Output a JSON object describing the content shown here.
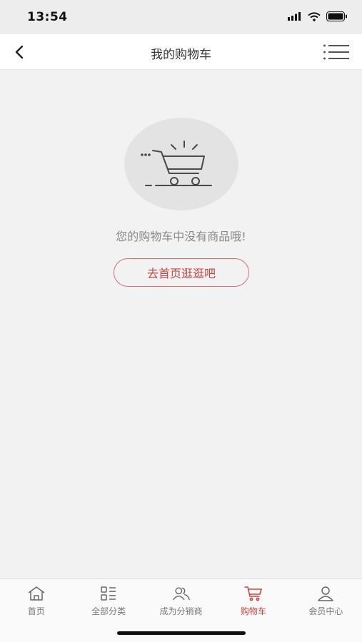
{
  "status_bar": {
    "time": "13:54"
  },
  "header": {
    "title": "我的购物车",
    "back_icon": "chevron-left-icon",
    "menu_icon": "list-menu-icon"
  },
  "empty_state": {
    "illustration": "shopping-cart-icon",
    "message": "您的购物车中没有商品哦!",
    "button_label": "去首页逛逛吧"
  },
  "colors": {
    "accent": "#c8453f",
    "background": "#f2f2f2",
    "header_bg": "#ffffff"
  },
  "tabs": [
    {
      "label": "首页",
      "icon": "home-icon",
      "active": false
    },
    {
      "label": "全部分类",
      "icon": "category-icon",
      "active": false
    },
    {
      "label": "成为分销商",
      "icon": "users-icon",
      "active": false
    },
    {
      "label": "购物车",
      "icon": "cart-icon",
      "active": true
    },
    {
      "label": "会员中心",
      "icon": "user-icon",
      "active": false
    }
  ]
}
